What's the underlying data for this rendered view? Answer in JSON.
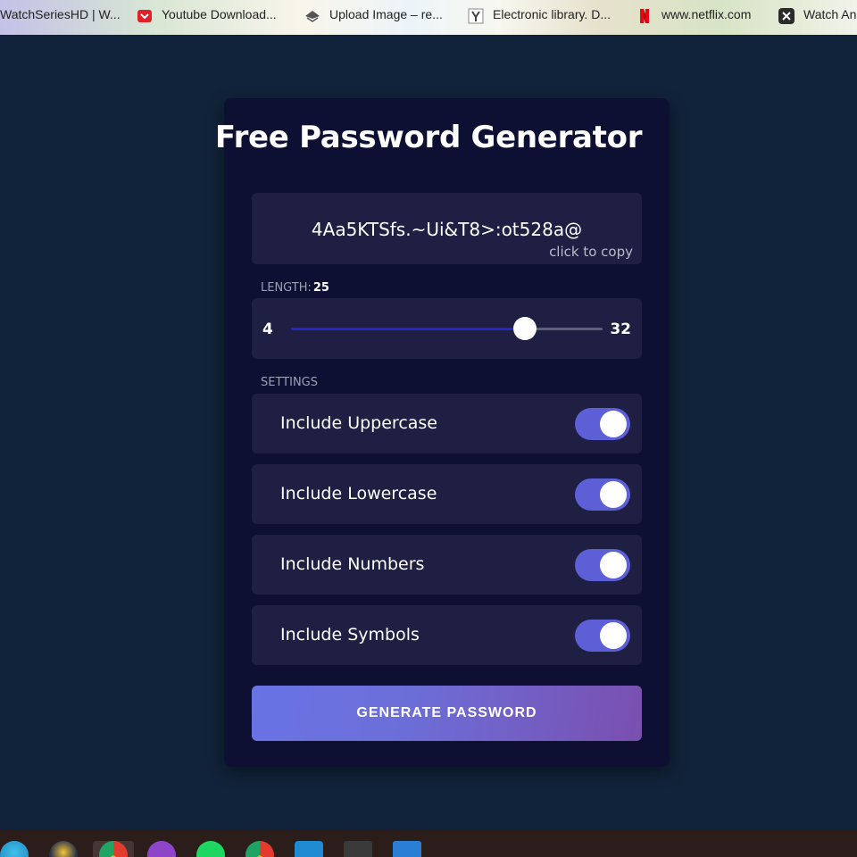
{
  "bookmarks": [
    {
      "label": "WatchSeriesHD | W...",
      "icon": "none"
    },
    {
      "label": "Youtube Download...",
      "icon": "youtube-download-icon",
      "color": "#e0202a"
    },
    {
      "label": "Upload Image – re...",
      "icon": "upload-image-icon",
      "color": "#555555"
    },
    {
      "label": "Electronic library. D...",
      "icon": "library-icon",
      "color": "#555555"
    },
    {
      "label": "www.netflix.com",
      "icon": "netflix-icon",
      "color": "#e50914"
    },
    {
      "label": "Watch An",
      "icon": "watch-anime-icon",
      "color": "#333333"
    }
  ],
  "app": {
    "title": "Free Password Generator",
    "password": "4Aa5KTSfs.~Ui&T8>:ot528a@",
    "copy_hint": "click to copy",
    "length_label": "LENGTH:",
    "length_value": "25",
    "length_min": "4",
    "length_max": "32",
    "settings_label": "SETTINGS",
    "settings": [
      {
        "label": "Include Uppercase",
        "checked": true
      },
      {
        "label": "Include Lowercase",
        "checked": true
      },
      {
        "label": "Include Numbers",
        "checked": true
      },
      {
        "label": "Include Symbols",
        "checked": true
      }
    ],
    "generate_label": "GENERATE PASSWORD",
    "colors": {
      "background": "#11233a",
      "card": "#0d1032",
      "panel": "#1e1f42",
      "toggle_on": "#5d5fd7",
      "slider_fill": "#2127c8",
      "button_gradient_start": "#6873e4",
      "button_gradient_end": "#7a4fb0"
    }
  },
  "taskbar": {
    "apps": [
      {
        "icon": "edge-icon"
      },
      {
        "icon": "app-icon"
      },
      {
        "icon": "chrome-icon",
        "active": true
      },
      {
        "icon": "github-icon"
      },
      {
        "icon": "spotify-icon"
      },
      {
        "icon": "chrome-profile-icon"
      },
      {
        "icon": "vscode-icon"
      },
      {
        "icon": "terminal-icon"
      },
      {
        "icon": "azure-icon"
      }
    ]
  }
}
